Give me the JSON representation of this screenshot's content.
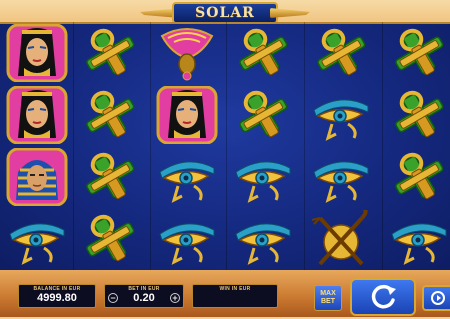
{
  "game": {
    "title": "SOLAR GOD",
    "colors": {
      "reel_bg": "#14287e",
      "panel": "#c9782f",
      "gold": "#d9a632",
      "button_blue": "#2a5ad0"
    }
  },
  "grid": {
    "columns": 6,
    "rows": 4,
    "cells": [
      [
        "cleopatra",
        "ankh",
        "scarab",
        "ankh",
        "ankh",
        "ankh"
      ],
      [
        "cleopatra",
        "ankh",
        "cleopatra",
        "ankh",
        "eye-of-horus",
        "ankh"
      ],
      [
        "pharaoh",
        "ankh",
        "eye-of-horus",
        "eye-of-horus",
        "eye-of-horus",
        "ankh"
      ],
      [
        "eye-of-horus",
        "ankh",
        "eye-of-horus",
        "eye-of-horus",
        "crook-and-flail",
        "eye-of-horus"
      ]
    ]
  },
  "panel": {
    "balance": {
      "label": "BALANCE IN EUR",
      "value": "4999.80"
    },
    "bet": {
      "label": "BET IN EUR",
      "value": "0.20",
      "minus": "−",
      "plus": "+"
    },
    "win": {
      "label": "WIN IN EUR",
      "value": ""
    },
    "max_bet": {
      "label": "MAX\nBET"
    },
    "spin_icon": "refresh-icon",
    "autoplay_icon": "autoplay-icon"
  }
}
